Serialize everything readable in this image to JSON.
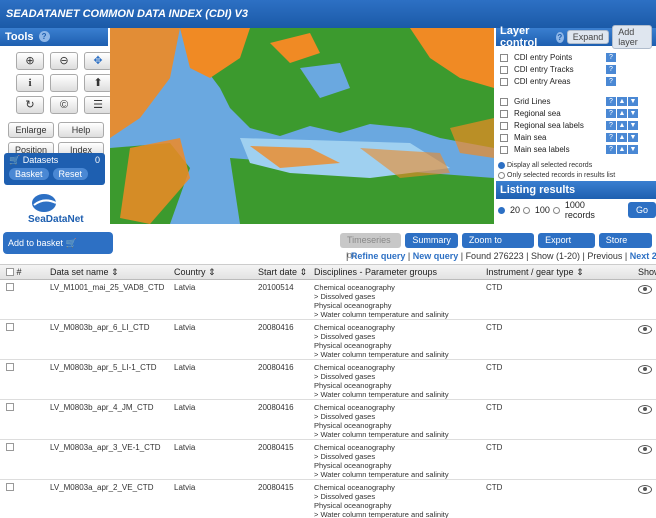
{
  "app": {
    "title": "SEADATANET COMMON DATA INDEX (CDI) V3"
  },
  "tools": {
    "title": "Tools",
    "icon_buttons": [
      "zoom-in-icon",
      "zoom-out-icon",
      "pan-icon",
      "info-icon",
      "select-icon",
      "refresh-icon",
      "copyright-icon",
      "list-icon"
    ],
    "enlarge": "Enlarge",
    "help": "Help",
    "position": "Position",
    "index": "Index"
  },
  "datasets": {
    "label": "Datasets",
    "count": "0",
    "basket": "Basket",
    "reset": "Reset"
  },
  "logo": {
    "text": "SeaDataNet"
  },
  "layer_control": {
    "title": "Layer control",
    "expand": "Expand",
    "add_layer": "Add layer",
    "layers_top": [
      "CDI entry Points",
      "CDI entry Tracks",
      "CDI entry Areas"
    ],
    "layers_bottom": [
      "Grid Lines",
      "Regional sea",
      "Regional sea labels",
      "Main sea",
      "Main sea labels"
    ],
    "display_all": "Display all selected records",
    "only_selected": "Only selected records in results list"
  },
  "listing": {
    "title": "Listing results",
    "options": [
      "20",
      "100",
      "1000 records"
    ],
    "selected": "20",
    "go": "Go"
  },
  "toolbar": {
    "add_basket": "Add to basket",
    "timeseries": "Timeseries on",
    "summary": "Summary",
    "zoom_selected": "Zoom to selected",
    "export": "Export result",
    "store": "Store query"
  },
  "query": {
    "refine": "Refine query",
    "new": "New query",
    "found": "Found 276223",
    "show": "Show (1-20)",
    "previous": "Previous",
    "next": "Next 20"
  },
  "table": {
    "headers": [
      "#",
      "Data set name",
      "Country",
      "Start date",
      "Disciplines - Parameter groups",
      "Instrument / gear type",
      "Show"
    ],
    "rows": [
      {
        "name": "LV_M1001_mai_25_VAD8_CTD",
        "country": "Latvia",
        "date": "20100514",
        "disc": [
          "Chemical oceanography",
          "> Dissolved gases",
          "Physical oceanography",
          "> Water column temperature and salinity"
        ],
        "instr": "CTD"
      },
      {
        "name": "LV_M0803b_apr_6_LI_CTD",
        "country": "Latvia",
        "date": "20080416",
        "disc": [
          "Chemical oceanography",
          "> Dissolved gases",
          "Physical oceanography",
          "> Water column temperature and salinity"
        ],
        "instr": "CTD"
      },
      {
        "name": "LV_M0803b_apr_5_LI-1_CTD",
        "country": "Latvia",
        "date": "20080416",
        "disc": [
          "Chemical oceanography",
          "> Dissolved gases",
          "Physical oceanography",
          "> Water column temperature and salinity"
        ],
        "instr": "CTD"
      },
      {
        "name": "LV_M0803b_apr_4_JM_CTD",
        "country": "Latvia",
        "date": "20080416",
        "disc": [
          "Chemical oceanography",
          "> Dissolved gases",
          "Physical oceanography",
          "> Water column temperature and salinity"
        ],
        "instr": "CTD"
      },
      {
        "name": "LV_M0803a_apr_3_VE-1_CTD",
        "country": "Latvia",
        "date": "20080415",
        "disc": [
          "Chemical oceanography",
          "> Dissolved gases",
          "Physical oceanography",
          "> Water column temperature and salinity"
        ],
        "instr": "CTD"
      },
      {
        "name": "LV_M0803a_apr_2_VE_CTD",
        "country": "Latvia",
        "date": "20080415",
        "disc": [
          "Chemical oceanography",
          "> Dissolved gases",
          "Physical oceanography",
          "> Water column temperature and salinity"
        ],
        "instr": "CTD"
      }
    ]
  },
  "colors": {
    "accent": "#2d70c4",
    "land": "#3c9a2e",
    "sea_points": "#f08a24",
    "sea": "#6aa8e0"
  }
}
